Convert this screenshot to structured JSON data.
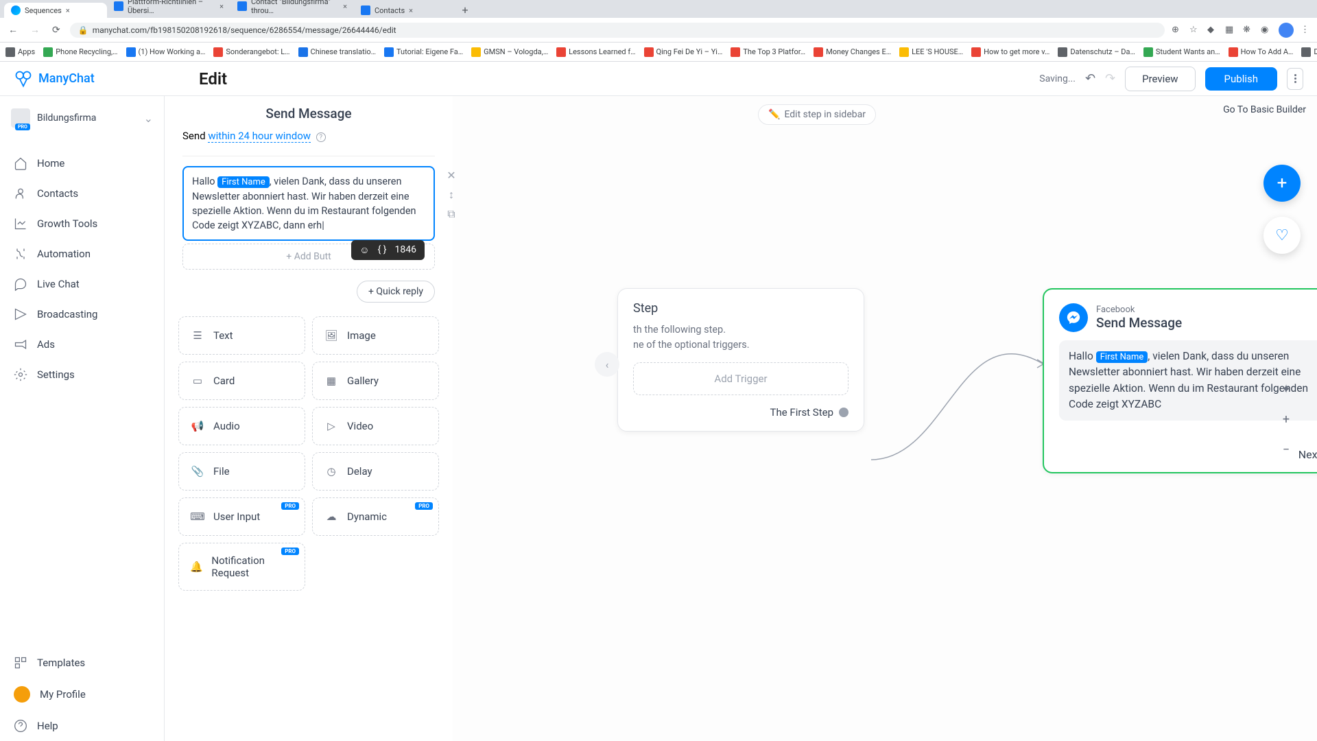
{
  "browser": {
    "tabs": [
      {
        "label": "Sequences",
        "active": true
      },
      {
        "label": "Plattform-Richtlinien – Übersi…"
      },
      {
        "label": "Contact \"Bildungsfirma\" throu…"
      },
      {
        "label": "Contacts"
      }
    ],
    "url": "manychat.com/fb198150208192618/sequence/6286554/message/26644446/edit",
    "bookmarks": [
      {
        "label": "Apps",
        "color": "#5f6368"
      },
      {
        "label": "Phone Recycling,…",
        "color": "#34a853"
      },
      {
        "label": "(1) How Working a…",
        "color": "#1877f2"
      },
      {
        "label": "Sonderangebot: L…",
        "color": "#ea4335"
      },
      {
        "label": "Chinese translatio…",
        "color": "#1a73e8"
      },
      {
        "label": "Tutorial: Eigene Fa…",
        "color": "#1877f2"
      },
      {
        "label": "GMSN – Vologda,…",
        "color": "#fbbc04"
      },
      {
        "label": "Lessons Learned f…",
        "color": "#ea4335"
      },
      {
        "label": "Qing Fei De Yi – Yi…",
        "color": "#ea4335"
      },
      {
        "label": "The Top 3 Platfor…",
        "color": "#ea4335"
      },
      {
        "label": "Money Changes E…",
        "color": "#ea4335"
      },
      {
        "label": "LEE 'S HOUSE…",
        "color": "#fbbc04"
      },
      {
        "label": "How to get more v…",
        "color": "#ea4335"
      },
      {
        "label": "Datenschutz – Da…",
        "color": "#5f6368"
      },
      {
        "label": "Student Wants an…",
        "color": "#34a853"
      },
      {
        "label": "How To Add A…",
        "color": "#ea4335"
      },
      {
        "label": "Download – Cooki…",
        "color": "#5f6368"
      }
    ]
  },
  "header": {
    "brand": "ManyChat",
    "title": "Edit",
    "status": "Saving...",
    "preview": "Preview",
    "publish": "Publish"
  },
  "workspace": {
    "name": "Bildungsfirma",
    "badge": "PRO"
  },
  "nav": [
    {
      "label": "Home",
      "icon": "home"
    },
    {
      "label": "Contacts",
      "icon": "contacts"
    },
    {
      "label": "Growth Tools",
      "icon": "growth"
    },
    {
      "label": "Automation",
      "icon": "automation"
    },
    {
      "label": "Live Chat",
      "icon": "chat"
    },
    {
      "label": "Broadcasting",
      "icon": "broadcast"
    },
    {
      "label": "Ads",
      "icon": "ads"
    },
    {
      "label": "Settings",
      "icon": "settings"
    }
  ],
  "nav_bottom": [
    {
      "label": "Templates",
      "icon": "templates"
    },
    {
      "label": "My Profile",
      "icon": "profile"
    },
    {
      "label": "Help",
      "icon": "help"
    }
  ],
  "panel": {
    "title": "Send Message",
    "send_prefix": "Send ",
    "send_window": "within 24 hour window",
    "msg_before": "Hallo ",
    "var": "First Name",
    "msg_after": ", vielen Dank, dass du unseren Newsletter abonniert hast. Wir haben derzeit eine spezielle Aktion. Wenn du im Restaurant folgenden Code zeigt XYZABC, dann erh",
    "add_button": "+ Add Butt",
    "char_count": "1846",
    "quick_reply": "+ Quick reply",
    "blocks": [
      {
        "label": "Text",
        "icon": "text"
      },
      {
        "label": "Image",
        "icon": "image"
      },
      {
        "label": "Card",
        "icon": "card"
      },
      {
        "label": "Gallery",
        "icon": "gallery"
      },
      {
        "label": "Audio",
        "icon": "audio"
      },
      {
        "label": "Video",
        "icon": "video"
      },
      {
        "label": "File",
        "icon": "file"
      },
      {
        "label": "Delay",
        "icon": "delay"
      },
      {
        "label": "User Input",
        "icon": "input",
        "pro": true
      },
      {
        "label": "Dynamic",
        "icon": "dynamic",
        "pro": true
      },
      {
        "label": "Notification Request",
        "icon": "notify",
        "pro": true,
        "double": true
      }
    ]
  },
  "canvas": {
    "edit_sidebar": "Edit step in sidebar",
    "go_basic": "Go To Basic Builder",
    "trigger": {
      "title": "Step",
      "desc1": "th the following step.",
      "desc2": "ne of the optional triggers.",
      "add_trigger": "Add Trigger",
      "first_step": "The First Step"
    },
    "message": {
      "sub": "Facebook",
      "main": "Send Message",
      "body_before": "Hallo ",
      "body_var": "First Name",
      "body_after": ", vielen Dank, dass du unseren Newsletter abonniert hast. Wir haben derzeit eine spezielle Aktion. Wenn du im Restaurant folgenden Code zeigt XYZABC",
      "next": "Next Step"
    }
  },
  "pro_text": "PRO"
}
